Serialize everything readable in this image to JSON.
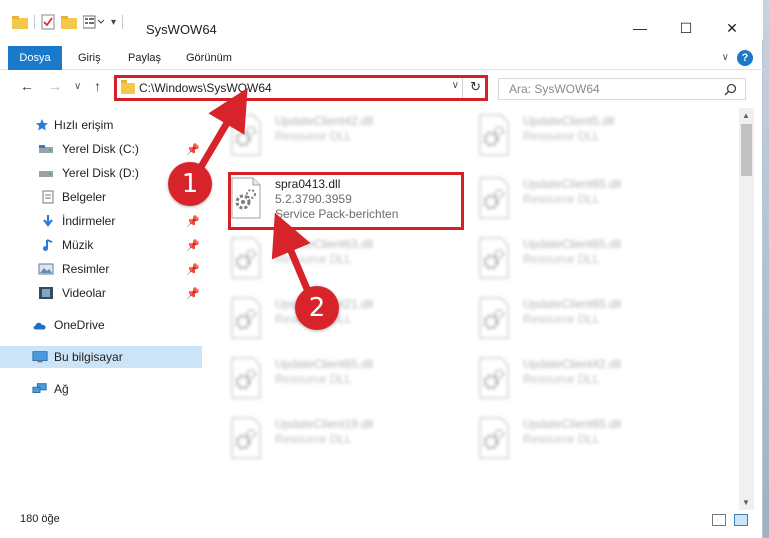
{
  "window": {
    "title": "SysWOW64",
    "minimize": "—",
    "maximize": "☐",
    "close": "✕"
  },
  "ribbon": {
    "file_tab": "Dosya",
    "tabs": [
      "Giriş",
      "Paylaş",
      "Görünüm"
    ],
    "help": "?",
    "collapse": "∨"
  },
  "nav": {
    "back": "←",
    "forward": "→",
    "recent": "∨",
    "up": "↑",
    "address": "C:\\Windows\\SysWOW64",
    "address_dropdown": "∨",
    "refresh": "↻",
    "search_placeholder": "Ara: SysWOW64",
    "search_icon": "search-icon"
  },
  "sidebar": {
    "items": [
      {
        "label": "Hızlı erişim",
        "icon": "star-icon",
        "pinned": false
      },
      {
        "label": "Yerel Disk (C:)",
        "icon": "drive-icon",
        "pinned": true
      },
      {
        "label": "Yerel Disk (D:)",
        "icon": "drive-icon",
        "pinned": true
      },
      {
        "label": "Belgeler",
        "icon": "documents-icon",
        "pinned": true
      },
      {
        "label": "İndirmeler",
        "icon": "downloads-icon",
        "pinned": true
      },
      {
        "label": "Müzik",
        "icon": "music-icon",
        "pinned": true
      },
      {
        "label": "Resimler",
        "icon": "pictures-icon",
        "pinned": true
      },
      {
        "label": "Videolar",
        "icon": "videos-icon",
        "pinned": true
      },
      {
        "label": "OneDrive",
        "icon": "cloud-icon",
        "pinned": false
      },
      {
        "label": "Bu bilgisayar",
        "icon": "computer-icon",
        "pinned": false,
        "selected": true
      },
      {
        "label": "Ağ",
        "icon": "network-icon",
        "pinned": false
      }
    ]
  },
  "files": [
    {
      "name": "UpdateClient42.dll",
      "type": "Resource DLL"
    },
    {
      "name": "UpdateClient5.dll",
      "type": "Resource DLL"
    },
    {
      "name": "spra0413.dll",
      "version": "5.2.3790.3959",
      "type": "Service Pack-berichten",
      "highlighted": true
    },
    {
      "name": "UpdateClient65.dll",
      "type": "Resource DLL"
    },
    {
      "name": "UpdateClient63.dll",
      "type": "Resource DLL"
    },
    {
      "name": "UpdateClient65.dll",
      "type": "Resource DLL"
    },
    {
      "name": "UpdateClient21.dll",
      "type": "Resource DLL"
    },
    {
      "name": "UpdateClient65.dll",
      "type": "Resource DLL"
    },
    {
      "name": "UpdateClient65.dll",
      "type": "Resource DLL"
    },
    {
      "name": "UpdateClient42.dll",
      "type": "Resource DLL"
    },
    {
      "name": "UpdateClient19.dll",
      "type": "Resource DLL"
    },
    {
      "name": "UpdateClient65.dll",
      "type": "Resource DLL"
    }
  ],
  "status": {
    "item_count": "180 öğe"
  },
  "callouts": [
    "1",
    "2"
  ],
  "colors": {
    "accent": "#1979ca",
    "highlight_red": "#d71f26",
    "callout_red": "#d7242a",
    "selection": "#cce4f7"
  }
}
